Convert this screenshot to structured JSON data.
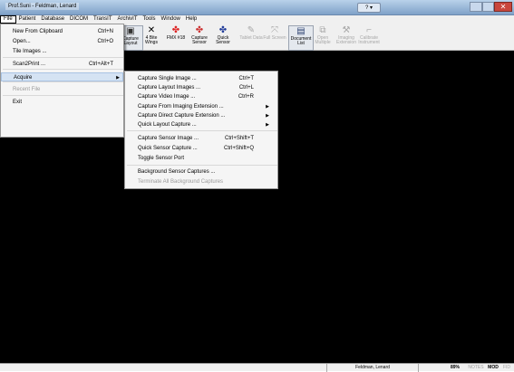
{
  "window": {
    "title": "Prof.Suni - Feldman, Lenard",
    "help_pill": "?  ▾",
    "close_glyph": "✕"
  },
  "menubar": [
    "File",
    "Patient",
    "Database",
    "DICOM",
    "TransIT",
    "ArchivIT",
    "Tools",
    "Window",
    "Help"
  ],
  "toolbar": [
    {
      "icon": "undo-icon",
      "label": "Undo",
      "glyph": "↶",
      "disabled": true
    },
    {
      "icon": "redo-icon",
      "label": "Redo",
      "glyph": "↷",
      "disabled": true
    },
    {
      "icon": "camera-icon",
      "label": "Capture Single",
      "glyph": "■",
      "disabled": false
    },
    {
      "icon": "camera-layout-icon",
      "label": "Capture Layout",
      "glyph": "▣",
      "disabled": false
    },
    {
      "icon": "bitewing-icon",
      "label": "4 Bite Wings",
      "glyph": "✕",
      "disabled": false
    },
    {
      "icon": "fmx-icon",
      "label": "FMX #18",
      "glyph": "✤",
      "disabled": false
    },
    {
      "icon": "sensor-icon",
      "label": "Capture Sensor",
      "glyph": "✤",
      "disabled": false
    },
    {
      "icon": "quick-sensor-icon",
      "label": "Quick Sensor",
      "glyph": "✤",
      "disabled": false
    },
    {
      "icon": "tablet-icon",
      "label": "Tablet Data",
      "glyph": "✎",
      "disabled": true
    },
    {
      "icon": "fullscreen-icon",
      "label": "Full Screen",
      "glyph": "⤧",
      "disabled": true
    },
    {
      "icon": "document-icon",
      "label": "Document List",
      "glyph": "▤",
      "disabled": false
    },
    {
      "icon": "open-multiple-icon",
      "label": "Open Multiple",
      "glyph": "⧉",
      "disabled": true
    },
    {
      "icon": "imaging-extension-icon",
      "label": "Imaging Extension",
      "glyph": "⚒",
      "disabled": true
    },
    {
      "icon": "calibrate-icon",
      "label": "Calibrate Instrument",
      "glyph": "⌐",
      "disabled": true
    }
  ],
  "file_menu": [
    {
      "label": "New From Clipboard",
      "shortcut": "Ctrl+N"
    },
    {
      "label": "Open...",
      "shortcut": "Ctrl+O"
    },
    {
      "label": "Tile Images ...",
      "shortcut": ""
    },
    {
      "label": "Scan2Print ...",
      "shortcut": "Ctrl+Alt+T"
    },
    {
      "label": "Acquire",
      "shortcut": "",
      "submenu": true
    },
    {
      "label": "Recent File",
      "shortcut": "",
      "disabled": true
    },
    {
      "label": "Exit",
      "shortcut": ""
    }
  ],
  "acquire_menu": [
    {
      "label": "Capture Single Image ...",
      "shortcut": "Ctrl+T"
    },
    {
      "label": "Capture Layout Images ...",
      "shortcut": "Ctrl+L"
    },
    {
      "label": "Capture Video Image ...",
      "shortcut": "Ctrl+R"
    },
    {
      "label": "Capture From Imaging Extension ...",
      "shortcut": "",
      "submenu": true
    },
    {
      "label": "Capture Direct Capture Extension ...",
      "shortcut": "",
      "submenu": true
    },
    {
      "label": "Quick Layout Capture ...",
      "shortcut": "",
      "submenu": true
    },
    {
      "label": "Capture Sensor Image ...",
      "shortcut": "Ctrl+Shift+T"
    },
    {
      "label": "Quick Sensor Capture ...",
      "shortcut": "Ctrl+Shift+Q"
    },
    {
      "label": "Toggle Sensor Port",
      "shortcut": ""
    },
    {
      "label": "Background Sensor Captures ...",
      "shortcut": ""
    },
    {
      "label": "Terminate All Background Captures",
      "shortcut": "",
      "disabled": true
    }
  ],
  "statusbar": {
    "user": "Feldman, Lenard",
    "zoom": "89%",
    "notes": "NOTES",
    "mode": "MOD",
    "extra": "FID"
  }
}
